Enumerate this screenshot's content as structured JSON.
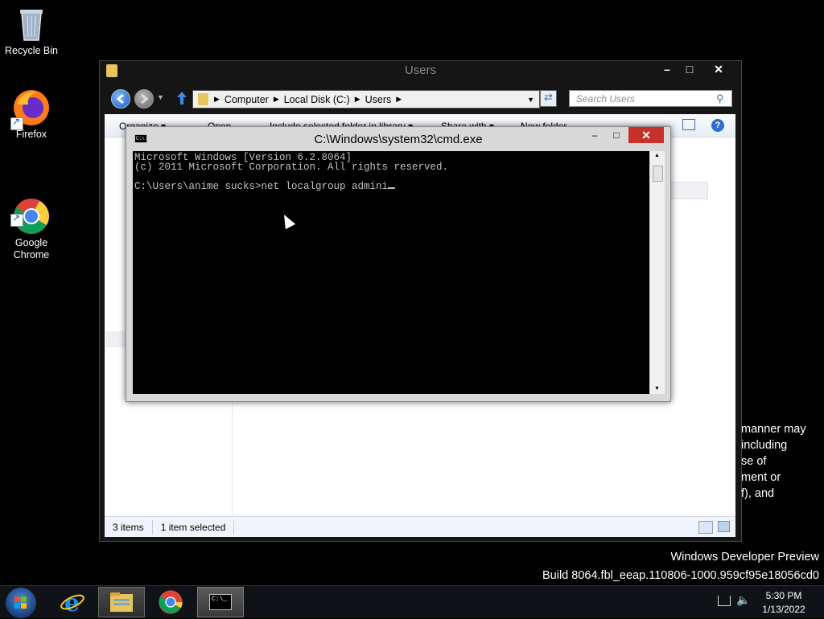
{
  "desktop": {
    "icons": [
      {
        "label": "Recycle Bin"
      },
      {
        "label": "Firefox"
      },
      {
        "label": "Google\nChrome"
      }
    ]
  },
  "explorer": {
    "title": "Users",
    "address": [
      "Computer",
      "Local Disk (C:)",
      "Users"
    ],
    "search_placeholder": "Search Users",
    "command_bar": [
      "Organize ▾",
      "Open",
      "Include selected folder in library ▾",
      "Share with ▾",
      "New folder"
    ],
    "status": {
      "items": "3 items",
      "selected": "1 item selected"
    }
  },
  "cmd": {
    "title": "C:\\Windows\\system32\\cmd.exe",
    "lines": [
      "Microsoft Windows [Version 6.2.8064]",
      "(c) 2011 Microsoft Corporation. All rights reserved.",
      "",
      "C:\\Users\\anime sucks>net localgroup admini"
    ]
  },
  "license_fragment": "manner may\nincluding\nse of\nment or\nf), and",
  "watermark": {
    "line1": "Windows Developer Preview",
    "line2": "Build 8064.fbl_eeap.110806-1000.959cf95e18056cd0"
  },
  "taskbar": {
    "apps": [
      "internet-explorer-icon",
      "file-explorer-icon",
      "chrome-icon",
      "command-prompt-icon"
    ],
    "active_app": "command-prompt-icon",
    "time": "5:30 PM",
    "date": "1/13/2022"
  },
  "colors": {
    "desktop_bg": "#000000",
    "console_bg": "#000000",
    "console_text": "#c0c0c0",
    "close_button": "#c7312a"
  }
}
